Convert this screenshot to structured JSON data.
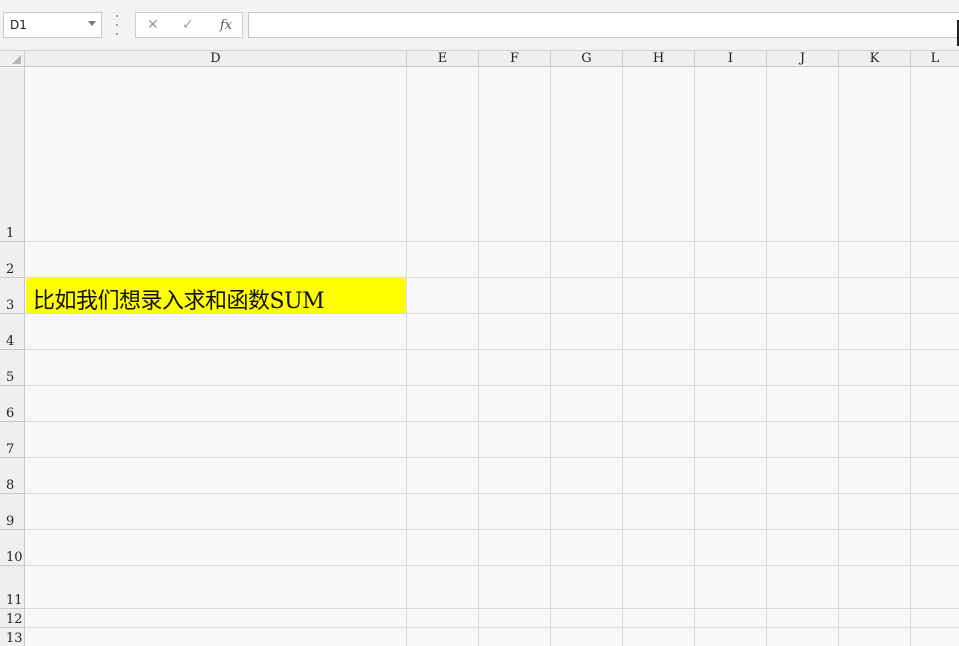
{
  "name_box": {
    "value": "D1"
  },
  "formula_bar": {
    "cancel_symbol": "✕",
    "enter_symbol": "✓",
    "fx_label": "fx",
    "formula": ""
  },
  "columns": [
    "D",
    "E",
    "F",
    "G",
    "H",
    "I",
    "J",
    "K",
    "L"
  ],
  "rows": [
    "1",
    "2",
    "3",
    "4",
    "5",
    "6",
    "7",
    "8",
    "9",
    "10",
    "11",
    "12",
    "13"
  ],
  "cells": {
    "D3": {
      "value": "比如我们想录入求和函数SUM",
      "fill": "#ffff00"
    }
  }
}
